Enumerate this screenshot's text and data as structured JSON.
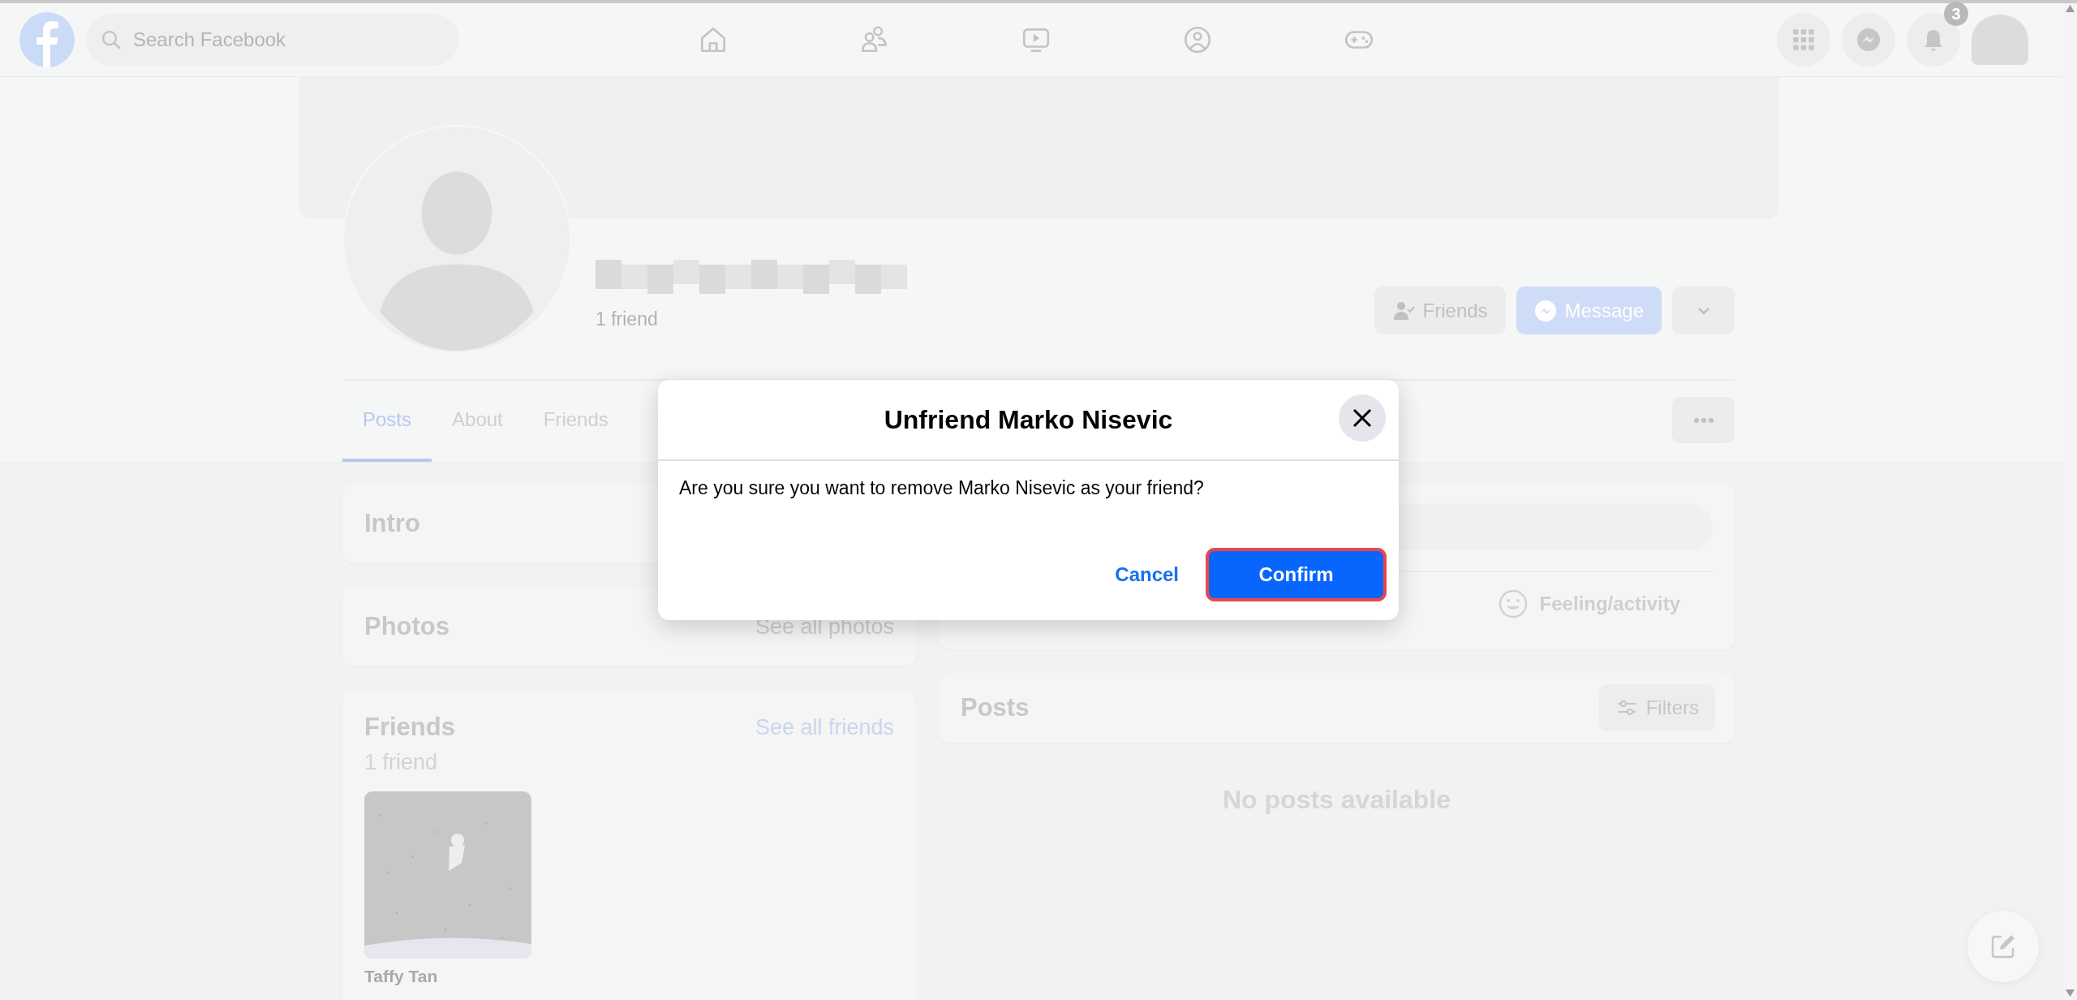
{
  "top_bar": {
    "search": {
      "placeholder": "Search Facebook"
    },
    "nav": [
      {
        "kind": "home"
      },
      {
        "kind": "friends"
      },
      {
        "kind": "watch"
      },
      {
        "kind": "groups"
      },
      {
        "kind": "gaming"
      }
    ],
    "notification_count": "3"
  },
  "profile": {
    "friend_count": "1 friend",
    "actions": [
      {
        "kind": "friends",
        "label": "Friends"
      },
      {
        "kind": "message",
        "label": "Message"
      },
      {
        "kind": "more"
      }
    ]
  },
  "tabs": [
    {
      "label": "Posts",
      "selected": true
    },
    {
      "label": "About",
      "selected": false
    },
    {
      "label": "Friends",
      "selected": false
    }
  ],
  "intro": {
    "title": "Intro"
  },
  "photos": {
    "title": "Photos",
    "link": "See all photos"
  },
  "friends": {
    "title": "Friends",
    "count": "1 friend",
    "link": "See all friends",
    "items": [
      {
        "name": "Taffy Tan"
      }
    ]
  },
  "composer": {
    "actions": [
      {
        "label": "Feeling/activity"
      }
    ]
  },
  "posts": {
    "title": "Posts",
    "filter_button": "Filters",
    "empty_message": "No posts available"
  },
  "dialog": {
    "title": "Unfriend Marko Nisevic",
    "message": "Are you sure you want to remove Marko Nisevic as your friend?",
    "cancel": "Cancel",
    "confirm": "Confirm",
    "confirm_highlighted": true
  }
}
